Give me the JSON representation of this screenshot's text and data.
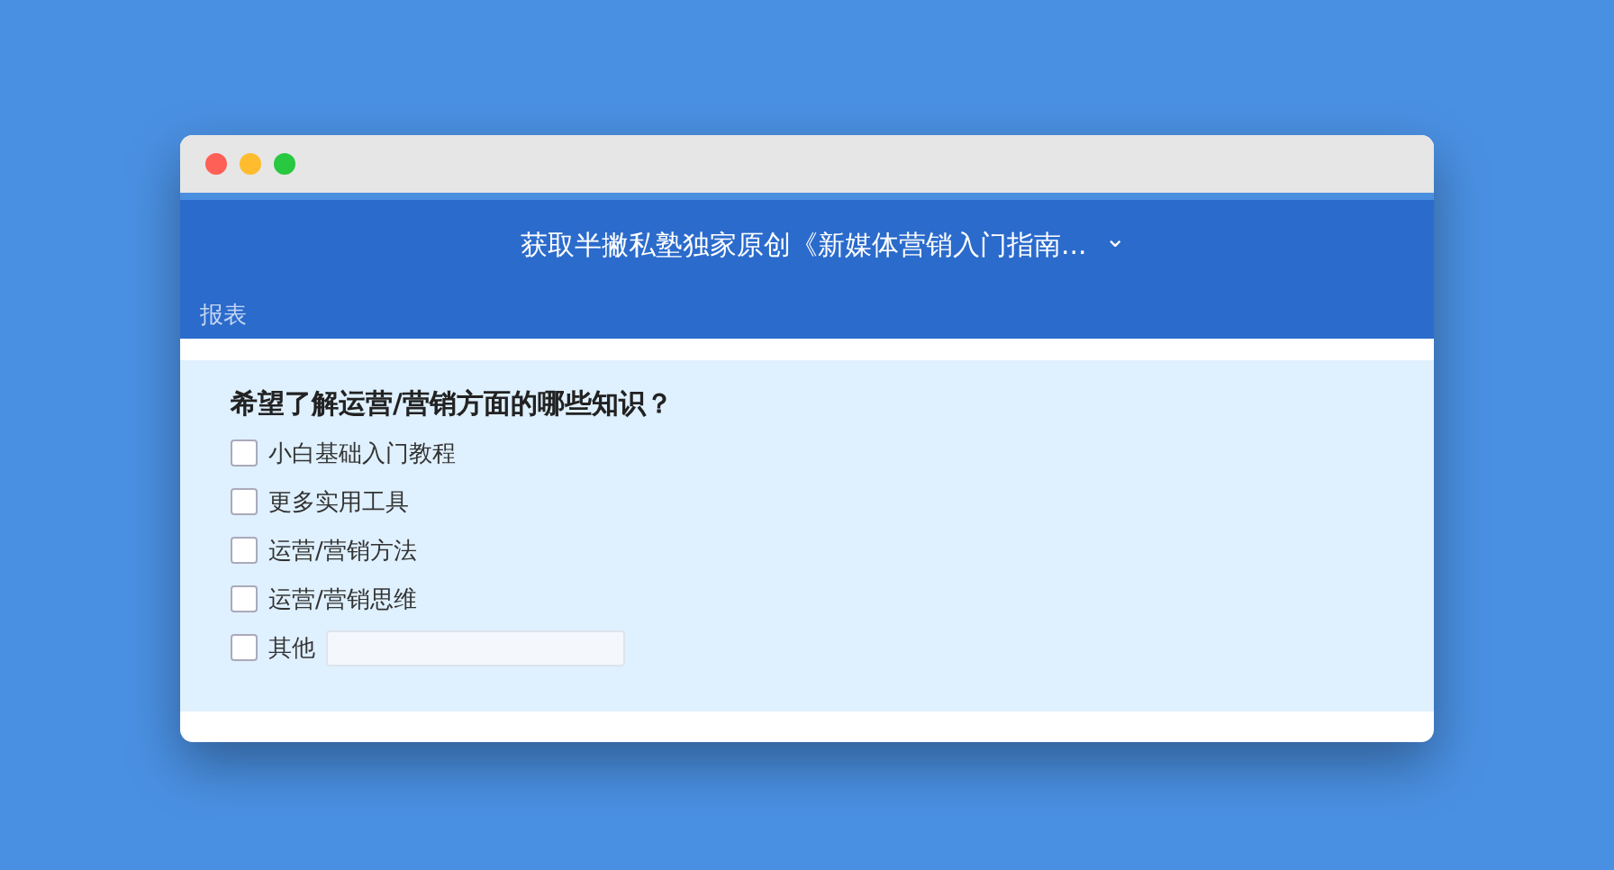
{
  "header": {
    "title": "获取半撇私塾独家原创《新媒体营销入门指南...",
    "dropdown_icon": "⌄",
    "tabs": [
      {
        "label": "报表",
        "selected": false
      }
    ]
  },
  "question": {
    "title": "希望了解运营/营销方面的哪些知识？",
    "options": [
      {
        "kind": "checkbox",
        "label": "小白基础入门教程",
        "checked": false
      },
      {
        "kind": "checkbox",
        "label": "更多实用工具",
        "checked": false
      },
      {
        "kind": "checkbox",
        "label": "运营/营销方法",
        "checked": false
      },
      {
        "kind": "checkbox",
        "label": "运营/营销思维",
        "checked": false
      },
      {
        "kind": "other",
        "label": "其他",
        "checked": false
      }
    ]
  }
}
